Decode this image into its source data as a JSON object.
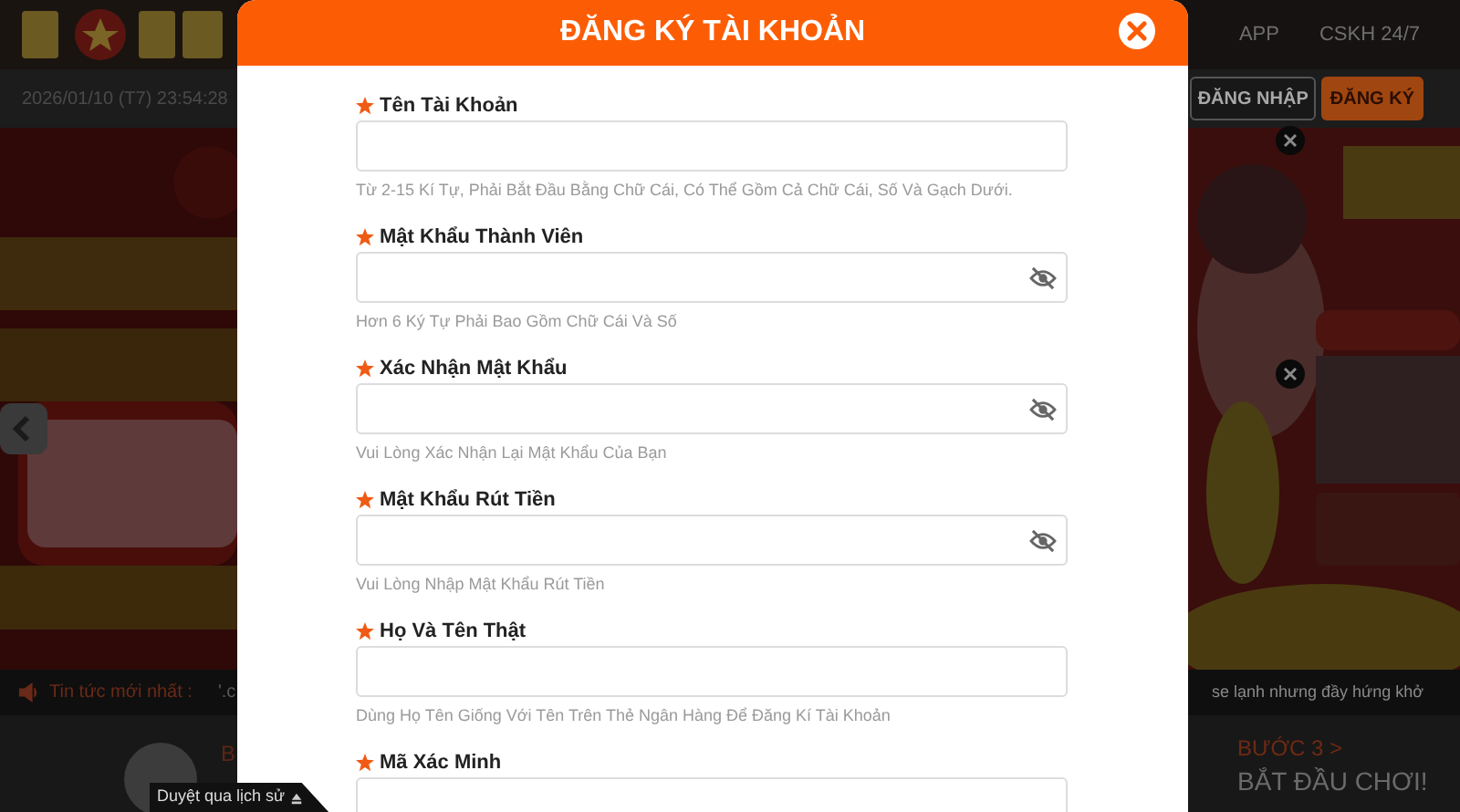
{
  "header": {
    "datetime": "2026/01/10 (T7) 23:54:28",
    "nav": [
      "APP",
      "CSKH 24/7"
    ],
    "buttons": [
      {
        "label": "ĐĂNG NHẬP",
        "kind": "outline"
      },
      {
        "label": "ĐĂNG KÝ",
        "kind": "filled"
      }
    ]
  },
  "ticker": {
    "label": "Tin tức mới nhất :",
    "text_start": "'.c",
    "text_end": "se lạnh nhưng đầy hứng khở"
  },
  "steps": [
    {
      "title": "B"
    },
    {
      "title": "BƯỚC 3 >",
      "text": "BẮT ĐẦU CHƠI!"
    }
  ],
  "history_tab": "Duyệt qua lịch sử",
  "modal": {
    "title": "ĐĂNG KÝ TÀI KHOẢN",
    "fields": [
      {
        "label": "Tên Tài Khoản",
        "required": true,
        "kind": "text",
        "hint": "Từ 2-15 Kí Tự, Phải Bắt Đầu Bằng Chữ Cái, Có Thể Gồm Cả Chữ Cái, Số Và Gạch Dưới."
      },
      {
        "label": "Mật Khẩu Thành Viên",
        "required": true,
        "kind": "password",
        "hint": "Hơn 6 Ký Tự Phải Bao Gồm Chữ Cái Và Số"
      },
      {
        "label": "Xác Nhận Mật Khẩu",
        "required": true,
        "kind": "password",
        "hint": "Vui Lòng Xác Nhận Lại Mật Khẩu Của Bạn"
      },
      {
        "label": "Mật Khẩu Rút Tiền",
        "required": true,
        "kind": "password",
        "hint": "Vui Lòng Nhập Mật Khẩu Rút Tiền"
      },
      {
        "label": "Họ Và Tên Thật",
        "required": true,
        "kind": "text",
        "hint": "Dùng Họ Tên Giống Với Tên Trên Thẻ Ngân Hàng Để Đăng Kí Tài Khoản"
      },
      {
        "label": "Mã Xác Minh",
        "required": true,
        "kind": "text"
      }
    ]
  }
}
